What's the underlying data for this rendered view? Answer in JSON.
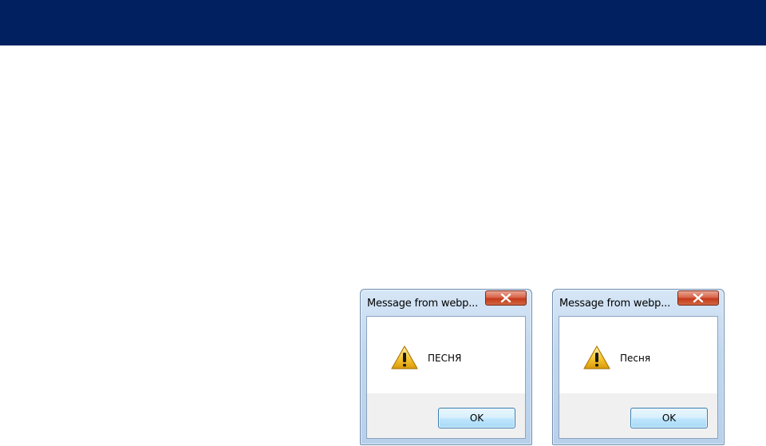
{
  "colors": {
    "banner": "#002060",
    "dialog_frame": "#c2d8ef",
    "close_button": "#c43a1c",
    "button_row": "#f0f0f0"
  },
  "dialogs": [
    {
      "title": "Message from webp...",
      "icon": "warning-icon",
      "message": "ПЕСНЯ",
      "ok_label": "OK",
      "close_icon": "close-x-icon"
    },
    {
      "title": "Message from webp...",
      "icon": "warning-icon",
      "message": "Песня",
      "ok_label": "OK",
      "close_icon": "close-x-icon"
    }
  ]
}
